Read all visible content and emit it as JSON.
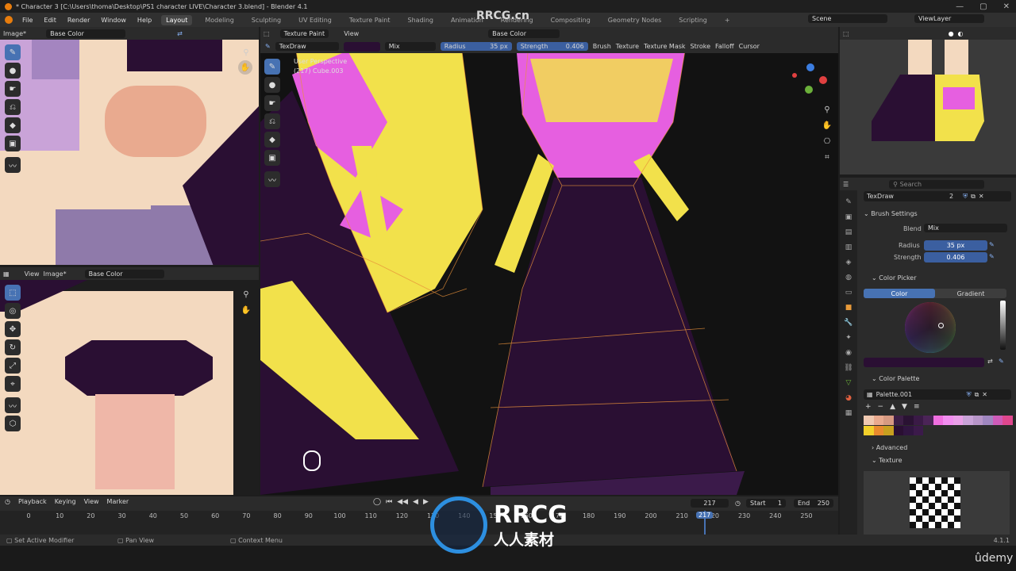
{
  "window": {
    "title": "* Character 3 [C:\\Users\\thoma\\Desktop\\PS1 character LIVE\\Character 3.blend] - Blender 4.1",
    "controls": [
      "—",
      "▢",
      "✕"
    ]
  },
  "menu": [
    "File",
    "Edit",
    "Render",
    "Window",
    "Help"
  ],
  "workspaces": [
    "Layout",
    "Modeling",
    "Sculpting",
    "UV Editing",
    "Texture Paint",
    "Shading",
    "Animation",
    "Rendering",
    "Compositing",
    "Geometry Nodes",
    "Scripting",
    "+"
  ],
  "scene": {
    "name": "Scene",
    "view_layer": "ViewLayer"
  },
  "image_editor_top": {
    "mode": "Image*",
    "image": "Base Color"
  },
  "image_editor_bottom": {
    "view": "View",
    "image_menu": "Image*",
    "image": "Base Color"
  },
  "viewport": {
    "mode": "Texture Paint",
    "view": "View",
    "texture_slot": "Base Color",
    "brush": "TexDraw",
    "blend": "Mix",
    "radius_label": "Radius",
    "radius": "35 px",
    "strength_label": "Strength",
    "strength": "0.406",
    "menus": [
      "Brush",
      "Texture",
      "Texture Mask",
      "Stroke",
      "Falloff",
      "Cursor"
    ],
    "overlay_line1": "User Perspective",
    "overlay_line2": "(217) Cube.003"
  },
  "properties": {
    "search_placeholder": "Search",
    "brush_name": "TexDraw",
    "brush_users": "2",
    "brush_settings": "Brush Settings",
    "blend_label": "Blend",
    "blend": "Mix",
    "radius_label": "Radius",
    "radius": "35 px",
    "strength_label": "Strength",
    "strength": "0.406",
    "color_picker": "Color Picker",
    "tab_color": "Color",
    "tab_gradient": "Gradient",
    "color_palette": "Color Palette",
    "palette_name": "Palette.001",
    "palette_row1": [
      "#f0c9b1",
      "#e9aa8f",
      "#d79a82",
      "#3c1e45",
      "#2a1233",
      "#3a1a46",
      "#4b2457",
      "#f06fe0",
      "#f28ef0",
      "#ea9fe8",
      "#c9a3d8",
      "#b795c8",
      "#9f86bf",
      "#ce5bb8",
      "#e0478e"
    ],
    "palette_row2": [
      "#f2d02b",
      "#e88a2e",
      "#c8a020",
      "#2a0f33",
      "#301540",
      "#3b1a4a"
    ],
    "advanced": "Advanced",
    "texture": "Texture"
  },
  "timeline": {
    "menus": [
      "Playback",
      "Keying",
      "View",
      "Marker"
    ],
    "current_frame": "217",
    "start_label": "Start",
    "start": "1",
    "end_label": "End",
    "end": "250",
    "ticks": [
      "0",
      "10",
      "20",
      "30",
      "40",
      "50",
      "60",
      "70",
      "80",
      "90",
      "100",
      "110",
      "120",
      "130",
      "140",
      "150",
      "160",
      "170",
      "180",
      "190",
      "200",
      "210",
      "220",
      "230",
      "240",
      "250"
    ],
    "playhead_label": "217"
  },
  "statusbar": {
    "left": "Set Active Modifier",
    "mid": "Pan View",
    "right": "Context Menu",
    "version": "4.1.1"
  },
  "watermark": {
    "brand": "RRCG",
    "cn": "人人素材",
    "top": "RRCG.cn"
  },
  "udemy": "ûdemy",
  "colors": {
    "accent": "#4772b3",
    "header": "#2b2b2b",
    "skin": "#f3d9bf",
    "purple": "#2a0f33",
    "yellow": "#f2e14b",
    "magenta": "#e65fe0"
  }
}
